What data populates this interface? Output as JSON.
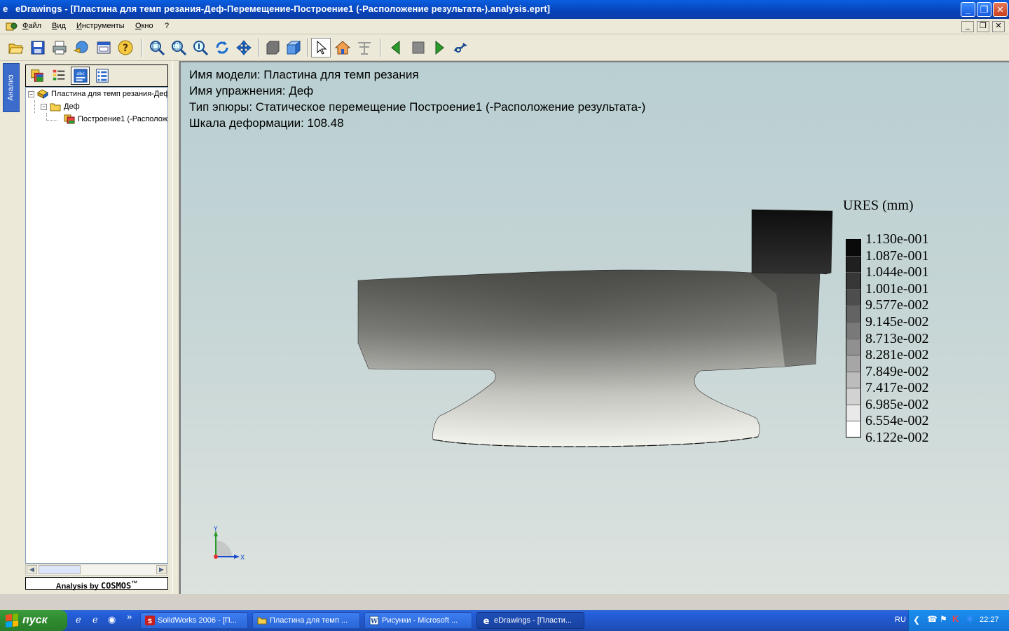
{
  "window": {
    "app_icon": "e",
    "title": "eDrawings - [Пластина для темп резания-Деф-Перемещение-Построение1 (-Расположение результата-).analysis.eprt]",
    "controls": {
      "minimize": "_",
      "restore": "❐",
      "close": "✕"
    }
  },
  "menu": {
    "items": [
      "Файл",
      "Вид",
      "Инструменты",
      "Окно",
      "?"
    ],
    "mdi_controls": {
      "minimize": "_",
      "restore": "❐",
      "close": "✕"
    }
  },
  "toolbar": {
    "buttons": [
      "open-icon",
      "save-icon",
      "print-icon",
      "send-icon",
      "options-icon",
      "help-icon",
      "zoom-fit-icon",
      "zoom-area-icon",
      "zoom-icon",
      "rotate-icon",
      "pan-icon",
      "shaded-icon",
      "perspective-icon",
      "select-icon",
      "home-icon",
      "markup-icon",
      "previous-icon",
      "stop-icon",
      "next-icon",
      "animate-icon"
    ]
  },
  "side_tab": {
    "label": "Анализ"
  },
  "tree": {
    "items": [
      {
        "label": "Пластина для темп резания-Деф",
        "icon": "part-icon",
        "expander": "−"
      },
      {
        "label": "Деф",
        "icon": "folder-icon",
        "expander": "−"
      },
      {
        "label": "Построение1 (-Располож",
        "icon": "plot-icon"
      }
    ]
  },
  "panel_footer": {
    "prefix": "Analysis by",
    "brand": "COSMOS",
    "mark": "™"
  },
  "viewport": {
    "info_lines": [
      "Имя модели: Пластина для темп резания",
      "Имя упражнения: Деф",
      "Тип эпюры: Статическое перемещение Построение1 (-Расположение результата-)",
      "Шкала деформации: 108.48"
    ],
    "legend": {
      "title": "URES (mm)",
      "values": [
        "1.130e-001",
        "1.087e-001",
        "1.044e-001",
        "1.001e-001",
        "9.577e-002",
        "9.145e-002",
        "8.713e-002",
        "8.281e-002",
        "7.849e-002",
        "7.417e-002",
        "6.985e-002",
        "6.554e-002",
        "6.122e-002"
      ],
      "color_top": "#0a0a0a",
      "color_bottom": "#ffffff"
    },
    "axis": {
      "y": "Y",
      "x": "X"
    }
  },
  "taskbar": {
    "start_label": "пуск",
    "quick_more": "»",
    "tasks": [
      {
        "label": "SolidWorks 2006 - [П...",
        "icon": "solidworks-icon",
        "active": false
      },
      {
        "label": "Пластина для темп ...",
        "icon": "folder-icon",
        "active": false
      },
      {
        "label": "Рисунки - Microsoft ...",
        "icon": "word-icon",
        "active": false
      },
      {
        "label": "eDrawings - [Пласти...",
        "icon": "edrawings-icon",
        "active": true
      }
    ],
    "lang": "RU",
    "clock": "22:27"
  }
}
